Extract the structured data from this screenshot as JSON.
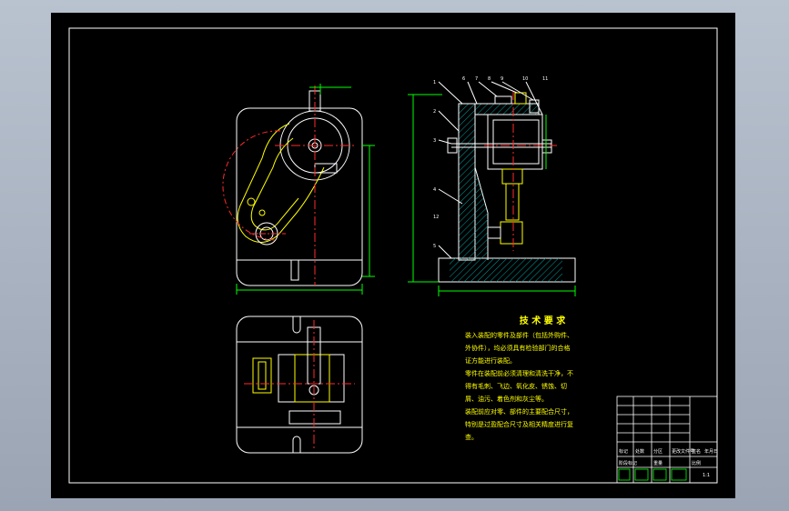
{
  "technical_requirements": {
    "title": "技 术 要 求",
    "lines": [
      "装入装配的零件及部件（包括外购件、外协件），均必须具有检验部门的合格证方能进行装配。",
      "零件在装配前必须清理和清洗干净，不得有毛刺、飞边、氧化皮、锈蚀、切屑、油污、着色剂和灰尘等。",
      "装配前应对零、部件的主要配合尺寸，特别是过盈配合尺寸及相关精度进行复查。"
    ]
  },
  "title_block": {
    "header_labels": [
      "标记",
      "处数",
      "分区",
      "更改文件号",
      "签名",
      "年月日"
    ],
    "bottom_labels": [
      "阶段标记",
      "重量",
      "比例"
    ],
    "scale": "1:1"
  },
  "balloons": [
    "1",
    "2",
    "3",
    "4",
    "5",
    "6",
    "7",
    "8",
    "9",
    "10",
    "11",
    "12"
  ],
  "colors": {
    "sheet": "#000000",
    "outline": "#ffffff",
    "part": "#ffff00",
    "center_line": "#ff2a2a",
    "dimension": "#00ff00",
    "hatch": "#00a0a0"
  }
}
